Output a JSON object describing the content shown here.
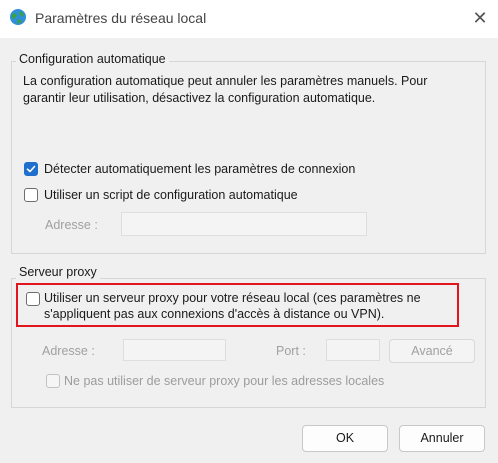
{
  "window": {
    "title": "Paramètres du réseau local",
    "icon": "network-globe-icon",
    "close_glyph": "✕"
  },
  "auto_config": {
    "group_title": "Configuration automatique",
    "description_line1": "La configuration automatique peut annuler les paramètres manuels. Pour",
    "description_line2": "garantir leur utilisation, désactivez la configuration automatique.",
    "detect_label": "Détecter automatiquement les paramètres de connexion",
    "detect_checked": true,
    "script_label": "Utiliser un script de configuration automatique",
    "script_checked": false,
    "address_label": "Adresse :",
    "address_value": ""
  },
  "proxy": {
    "group_title": "Serveur proxy",
    "use_proxy_line1": "Utiliser un serveur proxy pour votre réseau local (ces paramètres ne",
    "use_proxy_line2": "s'appliquent pas aux connexions d'accès à distance ou VPN).",
    "use_proxy_checked": false,
    "address_label": "Adresse :",
    "address_value": "",
    "port_label": "Port :",
    "port_value": "",
    "advanced_label": "Avancé",
    "bypass_label": "Ne pas utiliser de serveur proxy pour les adresses locales",
    "bypass_checked": false,
    "highlight_color": "#e2151f"
  },
  "buttons": {
    "ok_label": "OK",
    "cancel_label": "Annuler"
  }
}
